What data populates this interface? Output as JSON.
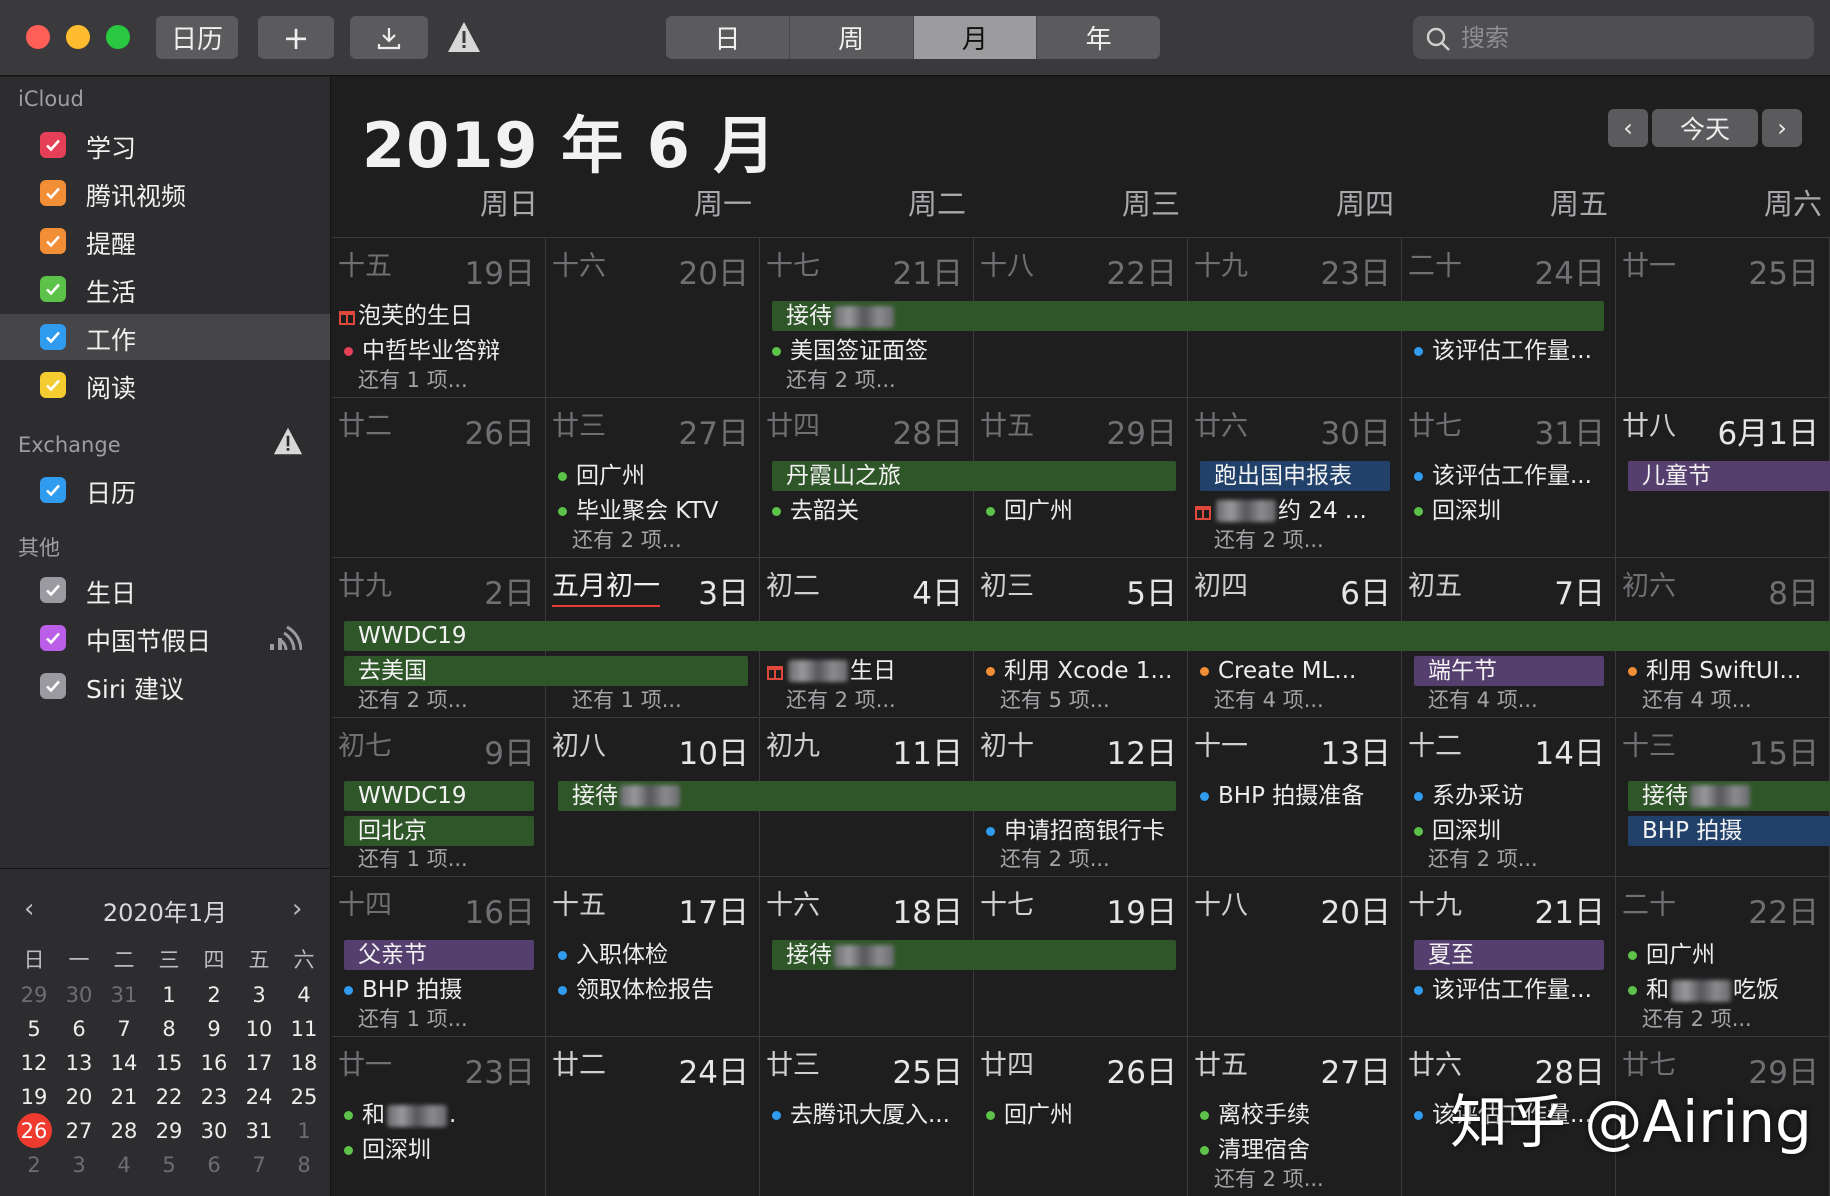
{
  "toolbar": {
    "calendars_button": "日历",
    "add_button": "+",
    "views": [
      "日",
      "周",
      "月",
      "年"
    ],
    "active_view": "月",
    "search_placeholder": "搜索"
  },
  "colors": {
    "close": "#ff5f57",
    "minimize": "#febc2e",
    "zoom": "#28c840",
    "today_circle": "#ef3a2f"
  },
  "sidebar": {
    "icloud_header": "iCloud",
    "icloud_items": [
      {
        "label": "学习",
        "color": "#e64059"
      },
      {
        "label": "腾讯视频",
        "color": "#f28e35"
      },
      {
        "label": "提醒",
        "color": "#f28e35"
      },
      {
        "label": "生活",
        "color": "#5cc24a"
      },
      {
        "label": "工作",
        "color": "#2f9cf0",
        "selected": true
      },
      {
        "label": "阅读",
        "color": "#f5cc2f"
      }
    ],
    "exchange_header": "Exchange",
    "exchange_items": [
      {
        "label": "日历",
        "color": "#2f9cf0"
      }
    ],
    "other_header": "其他",
    "other_items": [
      {
        "label": "生日",
        "color": "#9a9aa0"
      },
      {
        "label": "中国节假日",
        "color": "#bb5ee8"
      },
      {
        "label": "Siri 建议",
        "color": "#9a9aa0"
      }
    ]
  },
  "mini_calendar": {
    "title": "2020年1月",
    "weekdays": [
      "日",
      "一",
      "二",
      "三",
      "四",
      "五",
      "六"
    ],
    "weeks": [
      [
        "29",
        "30",
        "31",
        "1",
        "2",
        "3",
        "4"
      ],
      [
        "5",
        "6",
        "7",
        "8",
        "9",
        "10",
        "11"
      ],
      [
        "12",
        "13",
        "14",
        "15",
        "16",
        "17",
        "18"
      ],
      [
        "19",
        "20",
        "21",
        "22",
        "23",
        "24",
        "25"
      ],
      [
        "26",
        "27",
        "28",
        "29",
        "30",
        "31",
        "1"
      ],
      [
        "2",
        "3",
        "4",
        "5",
        "6",
        "7",
        "8"
      ]
    ],
    "today": "26"
  },
  "main": {
    "title": "2019 年 6 月",
    "today_button": "今天",
    "weekdays": [
      "周日",
      "周一",
      "周二",
      "周三",
      "周四",
      "周五",
      "周六"
    ]
  },
  "weeks": [
    {
      "days": [
        {
          "lunar": "十五",
          "date": "19日"
        },
        {
          "lunar": "十六",
          "date": "20日"
        },
        {
          "lunar": "十七",
          "date": "21日"
        },
        {
          "lunar": "十八",
          "date": "22日"
        },
        {
          "lunar": "十九",
          "date": "23日"
        },
        {
          "lunar": "二十",
          "date": "24日"
        },
        {
          "lunar": "廿一",
          "date": "25日"
        }
      ],
      "events": [
        {
          "kind": "gift",
          "col": 0,
          "row": 0,
          "text": "泡芙的生日"
        },
        {
          "kind": "bar",
          "color": "green",
          "start": 2,
          "end": 6,
          "row": 0,
          "text": "接待",
          "blur": true
        },
        {
          "kind": "dot",
          "col": 0,
          "row": 1,
          "text": "中哲毕业答辩",
          "dot": "#e64059"
        },
        {
          "kind": "dot",
          "col": 2,
          "row": 1,
          "text": "美国签证面签",
          "dot": "#5cc24a"
        },
        {
          "kind": "dot",
          "col": 5,
          "row": 1,
          "text": "该评估工作量...",
          "dot": "#2f9cf0"
        },
        {
          "kind": "more",
          "col": 0,
          "text": "还有 1 项..."
        },
        {
          "kind": "more",
          "col": 2,
          "text": "还有 2 项..."
        }
      ]
    },
    {
      "days": [
        {
          "lunar": "廿二",
          "date": "26日"
        },
        {
          "lunar": "廿三",
          "date": "27日"
        },
        {
          "lunar": "廿四",
          "date": "28日"
        },
        {
          "lunar": "廿五",
          "date": "29日"
        },
        {
          "lunar": "廿六",
          "date": "30日"
        },
        {
          "lunar": "廿七",
          "date": "31日"
        },
        {
          "lunar": "廿八",
          "date": "6月1日",
          "bright": true
        }
      ],
      "events": [
        {
          "kind": "bar",
          "color": "green",
          "start": 2,
          "end": 4,
          "row": 0,
          "text": "丹霞山之旅"
        },
        {
          "kind": "bar",
          "color": "blue",
          "start": 4,
          "end": 5,
          "row": 0,
          "text": "跑出国申报表"
        },
        {
          "kind": "bar",
          "color": "purple",
          "start": 6,
          "end": 7,
          "row": 0,
          "text": "儿童节"
        },
        {
          "kind": "dot",
          "col": 1,
          "row": 0,
          "text": "回广州",
          "dot": "#5cc24a"
        },
        {
          "kind": "dot",
          "col": 5,
          "row": 0,
          "text": "该评估工作量...",
          "dot": "#2f9cf0"
        },
        {
          "kind": "dot",
          "col": 1,
          "row": 1,
          "text": "毕业聚会 KTV",
          "dot": "#5cc24a"
        },
        {
          "kind": "dot",
          "col": 2,
          "row": 1,
          "text": "去韶关",
          "dot": "#5cc24a"
        },
        {
          "kind": "dot",
          "col": 3,
          "row": 1,
          "text": "回广州",
          "dot": "#5cc24a"
        },
        {
          "kind": "gift",
          "col": 4,
          "row": 1,
          "text": "约 24 ...",
          "blur": true
        },
        {
          "kind": "dot",
          "col": 5,
          "row": 1,
          "text": "回深圳",
          "dot": "#5cc24a"
        },
        {
          "kind": "more",
          "col": 1,
          "text": "还有 2 项..."
        },
        {
          "kind": "more",
          "col": 4,
          "text": "还有 2 项..."
        }
      ]
    },
    {
      "days": [
        {
          "lunar": "廿九",
          "date": "2日"
        },
        {
          "lunar": "五月初一",
          "date": "3日",
          "special": true,
          "bright": true
        },
        {
          "lunar": "初二",
          "date": "4日",
          "bright": true
        },
        {
          "lunar": "初三",
          "date": "5日",
          "bright": true
        },
        {
          "lunar": "初四",
          "date": "6日",
          "bright": true
        },
        {
          "lunar": "初五",
          "date": "7日",
          "bright": true
        },
        {
          "lunar": "初六",
          "date": "8日"
        }
      ],
      "events": [
        {
          "kind": "bar",
          "color": "green",
          "start": 0,
          "end": 7,
          "row": 0,
          "text": "WWDC19"
        },
        {
          "kind": "bar",
          "color": "green",
          "start": 0,
          "end": 2,
          "row": 1,
          "text": "去美国"
        },
        {
          "kind": "gift",
          "col": 2,
          "row": 1,
          "text": "生日",
          "blur": true
        },
        {
          "kind": "dot",
          "col": 3,
          "row": 1,
          "text": "利用 Xcode 1...",
          "dot": "#f28e35"
        },
        {
          "kind": "dot",
          "col": 4,
          "row": 1,
          "text": "Create ML...",
          "dot": "#f28e35"
        },
        {
          "kind": "bar",
          "color": "purple",
          "start": 5,
          "end": 6,
          "row": 1,
          "text": "端午节"
        },
        {
          "kind": "dot",
          "col": 6,
          "row": 1,
          "text": "利用 SwiftUI...",
          "dot": "#f28e35"
        },
        {
          "kind": "more",
          "col": 0,
          "text": "还有 2 项..."
        },
        {
          "kind": "more",
          "col": 1,
          "text": "还有 1 项..."
        },
        {
          "kind": "more",
          "col": 2,
          "text": "还有 2 项..."
        },
        {
          "kind": "more",
          "col": 3,
          "text": "还有 5 项..."
        },
        {
          "kind": "more",
          "col": 4,
          "text": "还有 4 项..."
        },
        {
          "kind": "more",
          "col": 5,
          "text": "还有 4 项..."
        },
        {
          "kind": "more",
          "col": 6,
          "text": "还有 4 项..."
        }
      ]
    },
    {
      "days": [
        {
          "lunar": "初七",
          "date": "9日"
        },
        {
          "lunar": "初八",
          "date": "10日",
          "bright": true
        },
        {
          "lunar": "初九",
          "date": "11日",
          "bright": true
        },
        {
          "lunar": "初十",
          "date": "12日",
          "bright": true
        },
        {
          "lunar": "十一",
          "date": "13日",
          "bright": true
        },
        {
          "lunar": "十二",
          "date": "14日",
          "bright": true
        },
        {
          "lunar": "十三",
          "date": "15日"
        }
      ],
      "events": [
        {
          "kind": "bar",
          "color": "green",
          "start": 0,
          "end": 1,
          "row": 0,
          "text": "WWDC19"
        },
        {
          "kind": "bar",
          "color": "green",
          "start": 1,
          "end": 4,
          "row": 0,
          "text": "接待",
          "blur": true
        },
        {
          "kind": "dot",
          "col": 4,
          "row": 0,
          "text": "BHP 拍摄准备",
          "dot": "#2f9cf0"
        },
        {
          "kind": "dot",
          "col": 5,
          "row": 0,
          "text": "系办采访",
          "dot": "#2f9cf0"
        },
        {
          "kind": "bar",
          "color": "green",
          "start": 6,
          "end": 7,
          "row": 0,
          "text": "接待",
          "blur": true
        },
        {
          "kind": "bar",
          "color": "green",
          "start": 0,
          "end": 1,
          "row": 1,
          "text": "回北京"
        },
        {
          "kind": "dot",
          "col": 3,
          "row": 1,
          "text": "申请招商银行卡",
          "dot": "#2f9cf0"
        },
        {
          "kind": "dot",
          "col": 5,
          "row": 1,
          "text": "回深圳",
          "dot": "#5cc24a"
        },
        {
          "kind": "bar",
          "color": "blue",
          "start": 6,
          "end": 7,
          "row": 1,
          "text": "BHP 拍摄"
        },
        {
          "kind": "more",
          "col": 0,
          "text": "还有 1 项..."
        },
        {
          "kind": "more",
          "col": 3,
          "text": "还有 2 项..."
        },
        {
          "kind": "more",
          "col": 5,
          "text": "还有 2 项..."
        }
      ]
    },
    {
      "days": [
        {
          "lunar": "十四",
          "date": "16日"
        },
        {
          "lunar": "十五",
          "date": "17日",
          "bright": true
        },
        {
          "lunar": "十六",
          "date": "18日",
          "bright": true
        },
        {
          "lunar": "十七",
          "date": "19日",
          "bright": true
        },
        {
          "lunar": "十八",
          "date": "20日",
          "bright": true
        },
        {
          "lunar": "十九",
          "date": "21日",
          "bright": true
        },
        {
          "lunar": "二十",
          "date": "22日"
        }
      ],
      "events": [
        {
          "kind": "bar",
          "color": "purple",
          "start": 0,
          "end": 1,
          "row": 0,
          "text": "父亲节"
        },
        {
          "kind": "dot",
          "col": 1,
          "row": 0,
          "text": "入职体检",
          "dot": "#2f9cf0"
        },
        {
          "kind": "bar",
          "color": "green",
          "start": 2,
          "end": 4,
          "row": 0,
          "text": "接待",
          "blur": true
        },
        {
          "kind": "bar",
          "color": "purple",
          "start": 5,
          "end": 6,
          "row": 0,
          "text": "夏至"
        },
        {
          "kind": "dot",
          "col": 6,
          "row": 0,
          "text": "回广州",
          "dot": "#5cc24a"
        },
        {
          "kind": "dot",
          "col": 0,
          "row": 1,
          "text": "BHP 拍摄",
          "dot": "#2f9cf0"
        },
        {
          "kind": "dot",
          "col": 1,
          "row": 1,
          "text": "领取体检报告",
          "dot": "#2f9cf0"
        },
        {
          "kind": "dot",
          "col": 5,
          "row": 1,
          "text": "该评估工作量...",
          "dot": "#2f9cf0"
        },
        {
          "kind": "dot",
          "col": 6,
          "row": 1,
          "text": "吃饭",
          "prefix": "和",
          "blur": true,
          "dot": "#5cc24a"
        },
        {
          "kind": "more",
          "col": 0,
          "text": "还有 1 项..."
        },
        {
          "kind": "more",
          "col": 6,
          "text": "还有 2 项..."
        }
      ]
    },
    {
      "days": [
        {
          "lunar": "廿一",
          "date": "23日"
        },
        {
          "lunar": "廿二",
          "date": "24日",
          "bright": true
        },
        {
          "lunar": "廿三",
          "date": "25日",
          "bright": true
        },
        {
          "lunar": "廿四",
          "date": "26日",
          "bright": true
        },
        {
          "lunar": "廿五",
          "date": "27日",
          "bright": true
        },
        {
          "lunar": "廿六",
          "date": "28日",
          "bright": true
        },
        {
          "lunar": "廿七",
          "date": "29日"
        }
      ],
      "events": [
        {
          "kind": "dot",
          "col": 0,
          "row": 0,
          "text": ".",
          "prefix": "和",
          "blur": true,
          "dot": "#5cc24a"
        },
        {
          "kind": "dot",
          "col": 2,
          "row": 0,
          "text": "去腾讯大厦入...",
          "dot": "#2f9cf0"
        },
        {
          "kind": "dot",
          "col": 3,
          "row": 0,
          "text": "回广州",
          "dot": "#5cc24a"
        },
        {
          "kind": "dot",
          "col": 4,
          "row": 0,
          "text": "离校手续",
          "dot": "#5cc24a"
        },
        {
          "kind": "dot",
          "col": 5,
          "row": 0,
          "text": "该评估工作量...",
          "dot": "#2f9cf0"
        },
        {
          "kind": "dot",
          "col": 0,
          "row": 1,
          "text": "回深圳",
          "dot": "#5cc24a"
        },
        {
          "kind": "dot",
          "col": 4,
          "row": 1,
          "text": "清理宿舍",
          "dot": "#5cc24a"
        },
        {
          "kind": "more",
          "col": 4,
          "text": "还有 2 项..."
        }
      ]
    }
  ],
  "watermark": "知乎 @Airing"
}
